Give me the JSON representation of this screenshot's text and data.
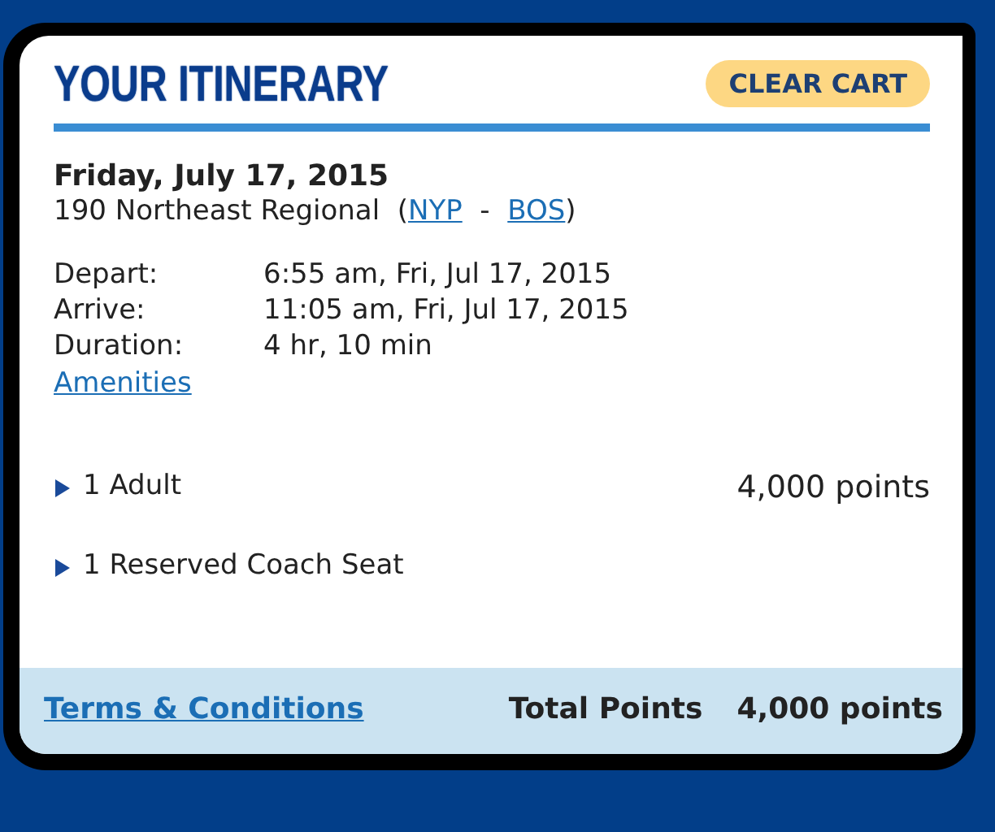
{
  "header": {
    "title": "YOUR ITINERARY",
    "clear_button": "CLEAR CART"
  },
  "trip": {
    "date": "Friday, July 17, 2015",
    "train": "190 Northeast Regional",
    "open_paren": "(",
    "origin": "NYP",
    "dash": "-",
    "destination": "BOS",
    "close_paren": ")"
  },
  "details": [
    {
      "label": "Depart:",
      "value": "6:55 am, Fri, Jul 17, 2015"
    },
    {
      "label": "Arrive:",
      "value": "11:05 am, Fri, Jul 17, 2015"
    },
    {
      "label": "Duration:",
      "value": "4 hr, 10 min"
    }
  ],
  "amenities_link": "Amenities",
  "line_items": [
    {
      "label": "1 Adult",
      "amount": "4,000 points"
    },
    {
      "label": "1 Reserved Coach Seat"
    }
  ],
  "footer": {
    "terms_link": "Terms & Conditions",
    "total_label": "Total Points",
    "total_value": "4,000 points"
  }
}
